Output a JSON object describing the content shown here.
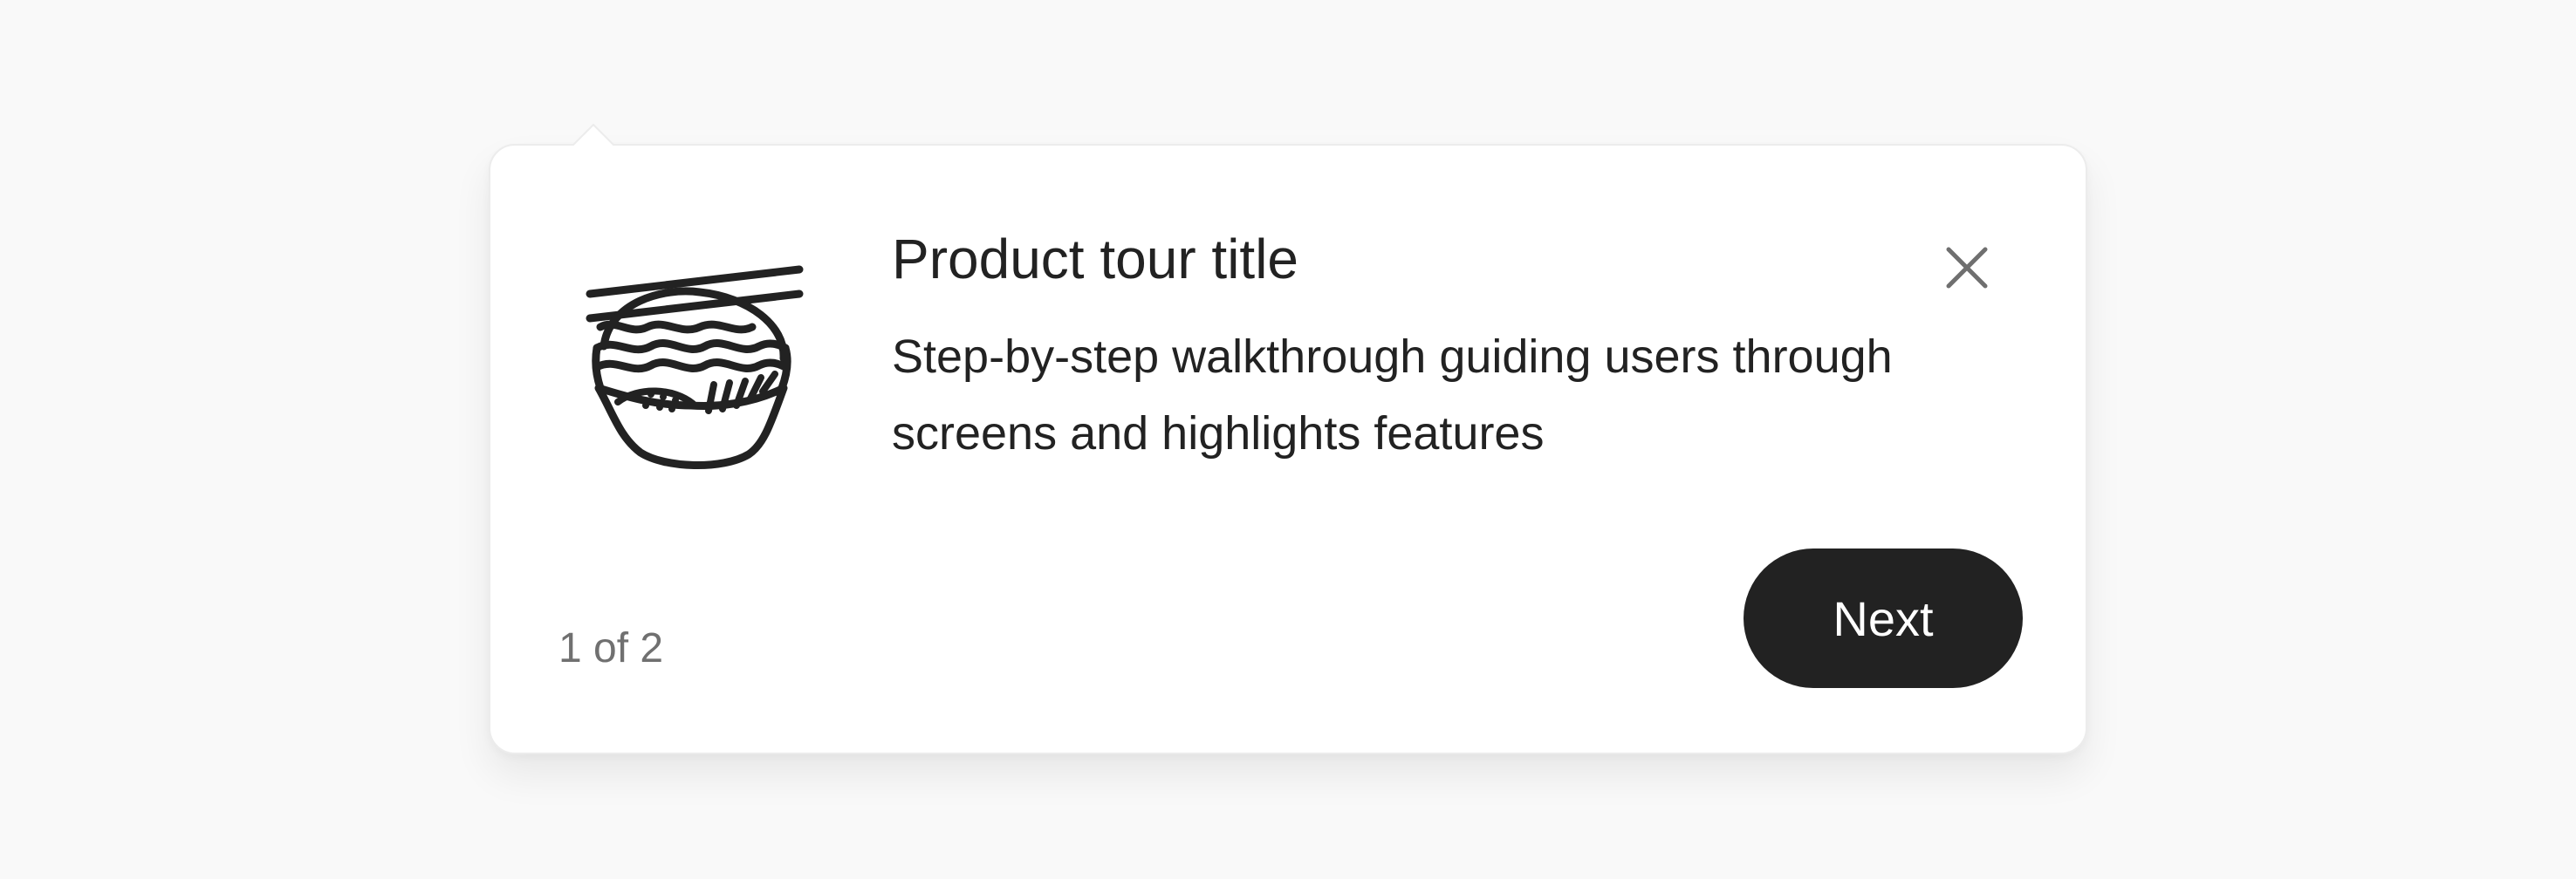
{
  "tour": {
    "illustration_icon": "noodle-bowl-with-chopsticks-icon",
    "title": "Product tour title",
    "description": "Step-by-step walkthrough guiding users through screens and highlights features",
    "close_icon": "close-icon",
    "step_counter": "1 of 2",
    "next_label": "Next"
  },
  "colors": {
    "background": "#f9f9f9",
    "card": "#ffffff",
    "text": "#222222",
    "muted_text": "#707070",
    "button": "#222222",
    "button_text": "#ffffff"
  }
}
